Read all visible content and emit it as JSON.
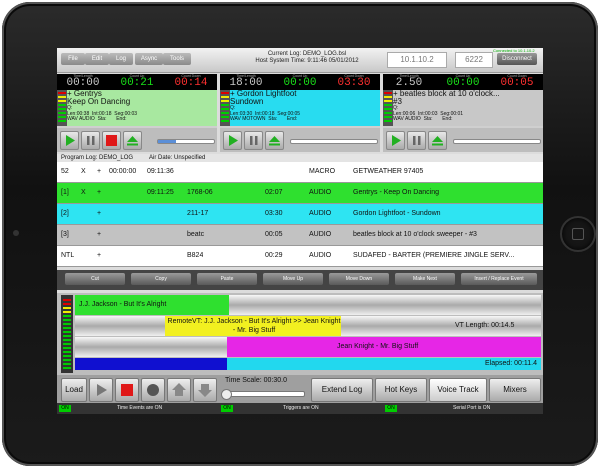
{
  "toolbar": {
    "buttons": [
      "File",
      "Edit",
      "Log",
      "Async",
      "Tools"
    ],
    "current_log": "Current Log: DEMO_LOG.bsl",
    "host_time": "Host System Time: 9:11:46  05/01/2012",
    "ip": "10.1.10.2",
    "port": "6222",
    "disconnect": "Disconnect",
    "connected": "Connected to 10.1.10.2"
  },
  "players": [
    {
      "labels": [
        "Time/Length",
        "Count Up",
        "Count Down"
      ],
      "times": [
        "00:00",
        "00:21",
        "00:14"
      ],
      "time_colors": [
        "#c8c8c8",
        "#19e019",
        "#ff3030"
      ],
      "bg": "#a8e8a0",
      "line1": "+ Gentrys",
      "line2": "Keep On Dancing",
      "cat": "Q:",
      "len": "Len:00:38",
      "intro": "Int:00:18",
      "seg": "Seg:00:03",
      "fmt": "WAV  AUDIO",
      "sta": "Sta:",
      "end": "End:"
    },
    {
      "labels": [
        "Time/Length",
        "Count Up",
        "Count Down"
      ],
      "times": [
        "18:00",
        "00:00",
        "03:30"
      ],
      "time_colors": [
        "#c8c8c8",
        "#19e019",
        "#ff3030"
      ],
      "bg": "#28dcf0",
      "line1": "+ Gordon Lightfoot",
      "line2": "Sundown",
      "cat": "Q:",
      "len": "Len:03:30",
      "intro": "Int:00:18",
      "seg": "Seg:00:05",
      "fmt": "WAV  MOTOWN",
      "sta": "Sta:",
      "end": "End:"
    },
    {
      "labels": [
        "Time/Length",
        "Count Up",
        "Count Down"
      ],
      "times": [
        "2.50",
        "00:00",
        "00:05"
      ],
      "time_colors": [
        "#c8c8c8",
        "#19e019",
        "#ff3030"
      ],
      "bg": "#c8c8c8",
      "line1": "+ beatles block at 10 o'clock...",
      "line2": "#3",
      "cat": "Q:",
      "len": "Len:00:06",
      "intro": "Int:00:03",
      "seg": "Seg:00:01",
      "fmt": "WAV  AUDIO",
      "sta": "Sta:",
      "end": "End:"
    }
  ],
  "log": {
    "program_log": "Program Log: DEMO_LOG",
    "air_date": "Air Date: Unspecified",
    "rows": [
      {
        "num": "52",
        "x": "X",
        "plus": "+",
        "start": "00:00:00",
        "airtime": "09:11:36",
        "cart": "",
        "len": "",
        "type": "MACRO",
        "title": "GETWEATHER 97405",
        "bg": "#ffffff"
      },
      {
        "num": "[1]",
        "x": "X",
        "plus": "+",
        "start": "",
        "airtime": "09:11:25",
        "cart": "1768-06",
        "len": "02:07",
        "type": "AUDIO",
        "title": "Gentrys - Keep On Dancing",
        "bg": "#2fe02f"
      },
      {
        "num": "[2]",
        "x": "",
        "plus": "+",
        "start": "",
        "airtime": "",
        "cart": "211-17",
        "len": "03:30",
        "type": "AUDIO",
        "title": "Gordon Lightfoot - Sundown",
        "bg": "#2ee4f2"
      },
      {
        "num": "[3]",
        "x": "",
        "plus": "+",
        "start": "",
        "airtime": "",
        "cart": "beatc",
        "len": "00:05",
        "type": "AUDIO",
        "title": "beatles block at 10 o'clock sweeper - #3",
        "bg": "#c2c2c2"
      },
      {
        "num": "NTL",
        "x": "",
        "plus": "+",
        "start": "",
        "airtime": "",
        "cart": "B824",
        "len": "00:29",
        "type": "AUDIO",
        "title": "SUDAFED - BARTER (PREMIERE JINGLE SERV...",
        "bg": "#ffffff"
      }
    ]
  },
  "edit_buttons": [
    "Cut",
    "Copy",
    "Paste",
    "Move Up",
    "Move Down",
    "Make Next",
    "Insert / Replace Event"
  ],
  "voicetrack": {
    "prev": "J.J. Jackson - But It's Alright",
    "remote": "RemoteVT: J.J. Jackson - But It's Alright >> Jean Knight - Mr. Big Stuff",
    "vt_length": "VT Length: 00:14.5",
    "next": "Jean Knight - Mr. Big Stuff",
    "elapsed": "Elapsed: 00:11.4"
  },
  "bottom": {
    "load": "Load",
    "time_scale": "Time Scale: 00:30.0",
    "extend_log": "Extend Log",
    "hot_keys": "Hot Keys",
    "voice_track": "Voice Track",
    "mixers": "Mixers"
  },
  "status": {
    "on": "ON",
    "time_events": "Time Events are ON",
    "triggers": "Triggers are ON",
    "serial": "Serial Port is ON"
  }
}
